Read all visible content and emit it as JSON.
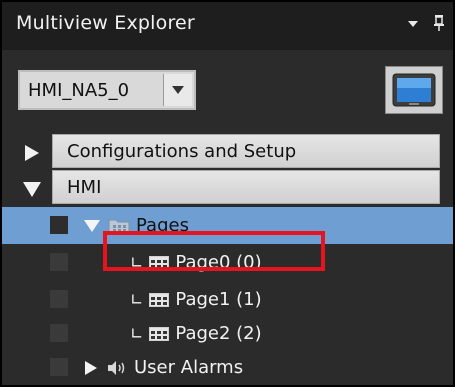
{
  "panel": {
    "title": "Multiview Explorer",
    "dropdown_glyph": "▼",
    "pin_glyph": "pin-icon"
  },
  "device": {
    "selected": "HMI_NA5_0",
    "monitor_icon": "monitor-icon"
  },
  "sections": [
    {
      "label": "Configurations and Setup",
      "expanded": false
    },
    {
      "label": "HMI",
      "expanded": true
    }
  ],
  "tree": {
    "pages": {
      "label": "Pages",
      "icon": "folder-icon",
      "expanded": true,
      "selected": true
    },
    "page_items": [
      {
        "label": "Page0 (0)",
        "icon": "page-grid-icon",
        "highlighted": true
      },
      {
        "label": "Page1 (1)",
        "icon": "page-grid-icon",
        "highlighted": false
      },
      {
        "label": "Page2 (2)",
        "icon": "page-grid-icon",
        "highlighted": false
      }
    ],
    "user_alarms": {
      "label": "User Alarms",
      "icon": "speaker-icon",
      "expanded": false
    }
  },
  "colors": {
    "selection": "#6f9fd2",
    "highlight_box": "#e6141e",
    "panel_bg": "#2b2b2b"
  }
}
